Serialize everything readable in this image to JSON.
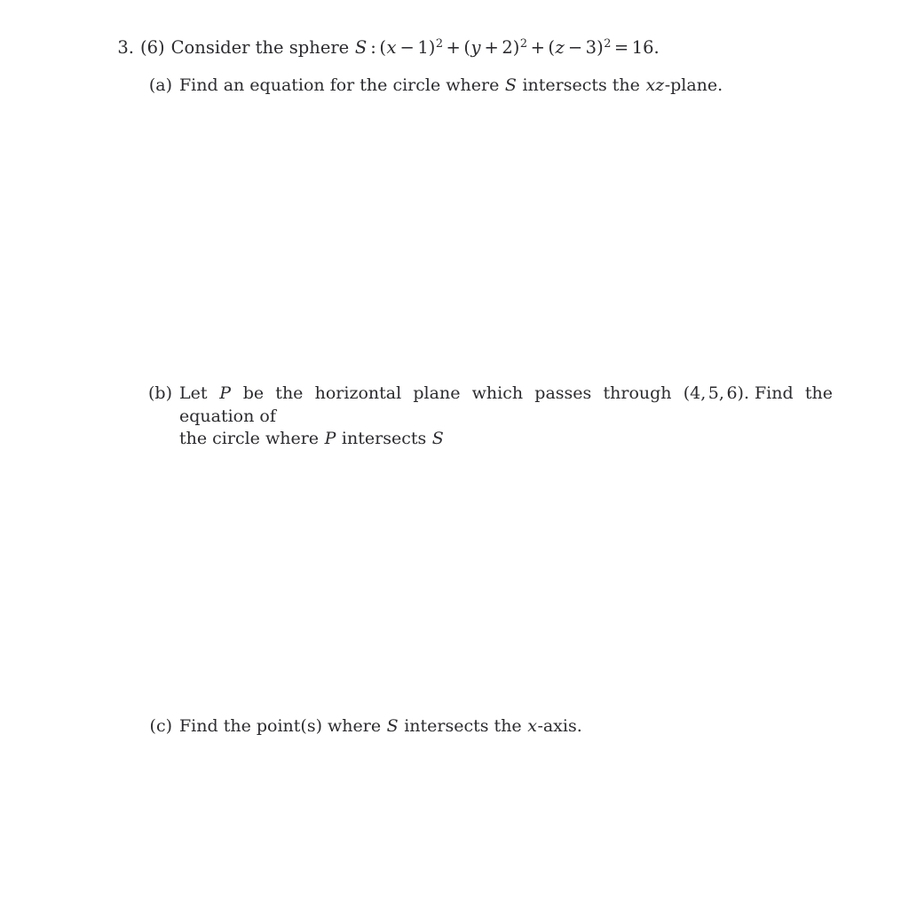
{
  "document": {
    "type": "math-worksheet",
    "background_color": "#ffffff",
    "text_color": "#2b2b2f"
  },
  "problem": {
    "number": "3.",
    "points": "(6)",
    "stem_prefix": "Consider the sphere",
    "equation": {
      "set_name": "S",
      "colon": ":",
      "terms": [
        {
          "var": "x",
          "sign": "−",
          "constant": "1",
          "exponent": "2"
        },
        {
          "var": "y",
          "sign": "+",
          "constant": "2",
          "exponent": "2"
        },
        {
          "var": "z",
          "sign": "−",
          "constant": "3",
          "exponent": "2"
        }
      ],
      "equals": "=",
      "rhs": "16",
      "terminator": ".",
      "plain_text": "S : (x − 1)² + (y + 2)² + (z − 3)² = 16."
    }
  },
  "parts": {
    "a": {
      "label": "(a)",
      "text_1": "Find an equation for the circle where",
      "var_1": "S",
      "text_2": "intersects the",
      "var_2": "xz",
      "text_3": "-plane.",
      "plain_text": "Find an equation for the circle where S intersects the xz-plane."
    },
    "b": {
      "label": "(b)",
      "line_1": {
        "text_1": "Let",
        "var_1": "P",
        "text_2": "be the horizontal plane which passes through",
        "point": {
          "open": "(",
          "x": "4",
          "y": "5",
          "z": "6",
          "close": ")",
          "comma": ","
        },
        "text_3": ".",
        "text_4": "Find the equation of"
      },
      "line_2": {
        "text_1": "the circle where",
        "var_1": "P",
        "text_2": "intersects",
        "var_2": "S"
      },
      "plain_text": "Let P be the horizontal plane which passes through (4, 5, 6). Find the equation of the circle where P intersects S"
    },
    "c": {
      "label": "(c)",
      "text_1": "Find the point(s) where",
      "var_1": "S",
      "text_2": "intersects the",
      "var_2": "x",
      "text_3": "-axis.",
      "plain_text": "Find the point(s) where S intersects the x-axis."
    }
  }
}
